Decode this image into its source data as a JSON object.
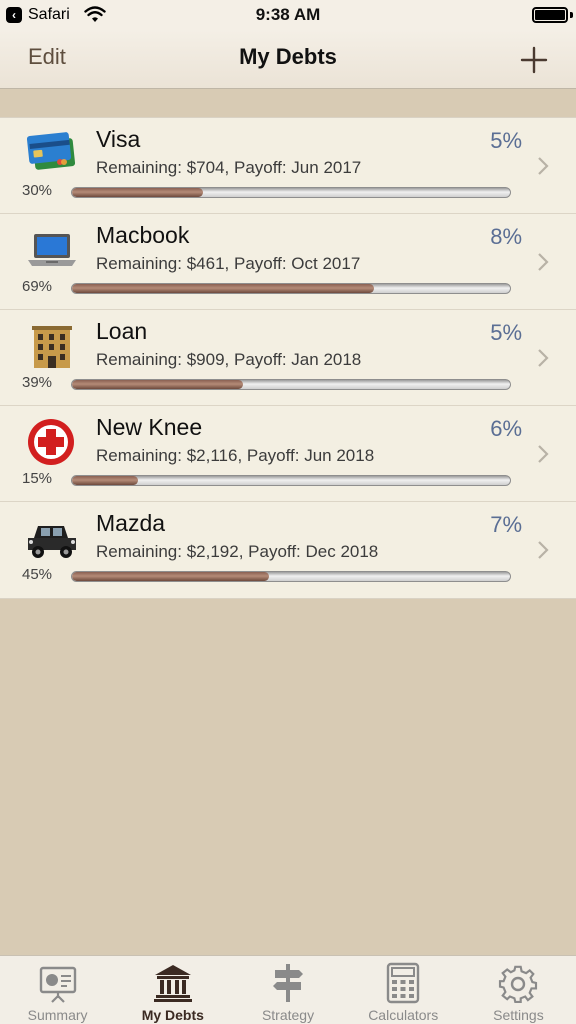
{
  "status": {
    "back_app": "Safari",
    "time": "9:38 AM"
  },
  "nav": {
    "edit_label": "Edit",
    "title": "My Debts",
    "add_icon": "plus-icon"
  },
  "debts": [
    {
      "icon": "credit-card-icon",
      "name": "Visa",
      "rate": "5%",
      "detail": "Remaining: $704, Payoff: Jun 2017",
      "progress_label": "30%",
      "progress": 0.3
    },
    {
      "icon": "laptop-icon",
      "name": "Macbook",
      "rate": "8%",
      "detail": "Remaining: $461, Payoff: Oct 2017",
      "progress_label": "69%",
      "progress": 0.69
    },
    {
      "icon": "building-icon",
      "name": "Loan",
      "rate": "5%",
      "detail": "Remaining: $909, Payoff: Jan 2018",
      "progress_label": "39%",
      "progress": 0.39
    },
    {
      "icon": "medical-cross-icon",
      "name": "New Knee",
      "rate": "6%",
      "detail": "Remaining: $2,116, Payoff: Jun 2018",
      "progress_label": "15%",
      "progress": 0.15
    },
    {
      "icon": "car-icon",
      "name": "Mazda",
      "rate": "7%",
      "detail": "Remaining: $2,192, Payoff: Dec 2018",
      "progress_label": "45%",
      "progress": 0.45
    }
  ],
  "tabs": [
    {
      "label": "Summary",
      "icon": "presentation-icon",
      "active": false
    },
    {
      "label": "My Debts",
      "icon": "bank-icon",
      "active": true
    },
    {
      "label": "Strategy",
      "icon": "signpost-icon",
      "active": false
    },
    {
      "label": "Calculators",
      "icon": "calculator-icon",
      "active": false
    },
    {
      "label": "Settings",
      "icon": "gear-icon",
      "active": false
    }
  ],
  "colors": {
    "rate_text": "#5a6e94",
    "progress_fill": "#8a6152",
    "background": "#d8cbb4"
  }
}
